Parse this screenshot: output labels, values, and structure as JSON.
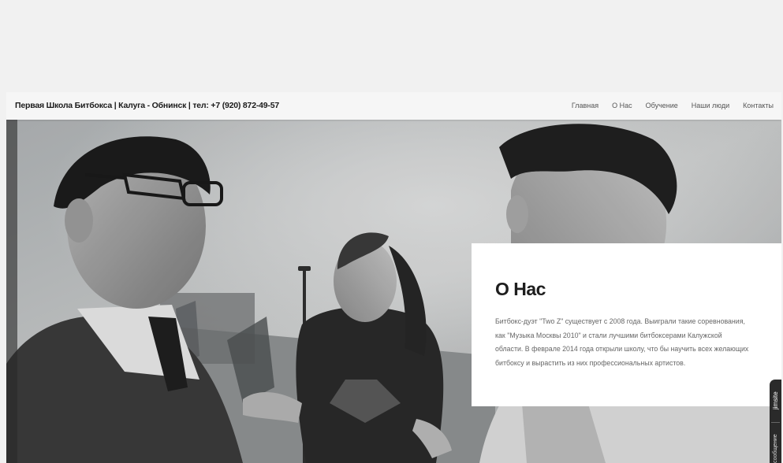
{
  "header": {
    "brand": "Первая Школа Битбокса | Калуга - Обнинск | тел: +7 (920) 872-49-57",
    "nav": [
      "Главная",
      "О Нас",
      "Обучение",
      "Наши люди",
      "Контакты"
    ]
  },
  "about": {
    "title": "О Нас",
    "lines": [
      "Битбокс-дуэт \"Two Z\" существует с 2008 года. Выиграли такие соревнования,",
      "как \"Музыка Москвы 2010\" и стали лучшими битбоксерами Калужской",
      "области. В феврале 2014 года открыли школу, что бы научить всех желающих",
      "битбоксу и вырастить из них профессиональных артистов."
    ]
  },
  "widget": {
    "logo": "jimsite",
    "message": "сообщение"
  },
  "hero": {
    "image_description_icon": "photo-icon"
  }
}
